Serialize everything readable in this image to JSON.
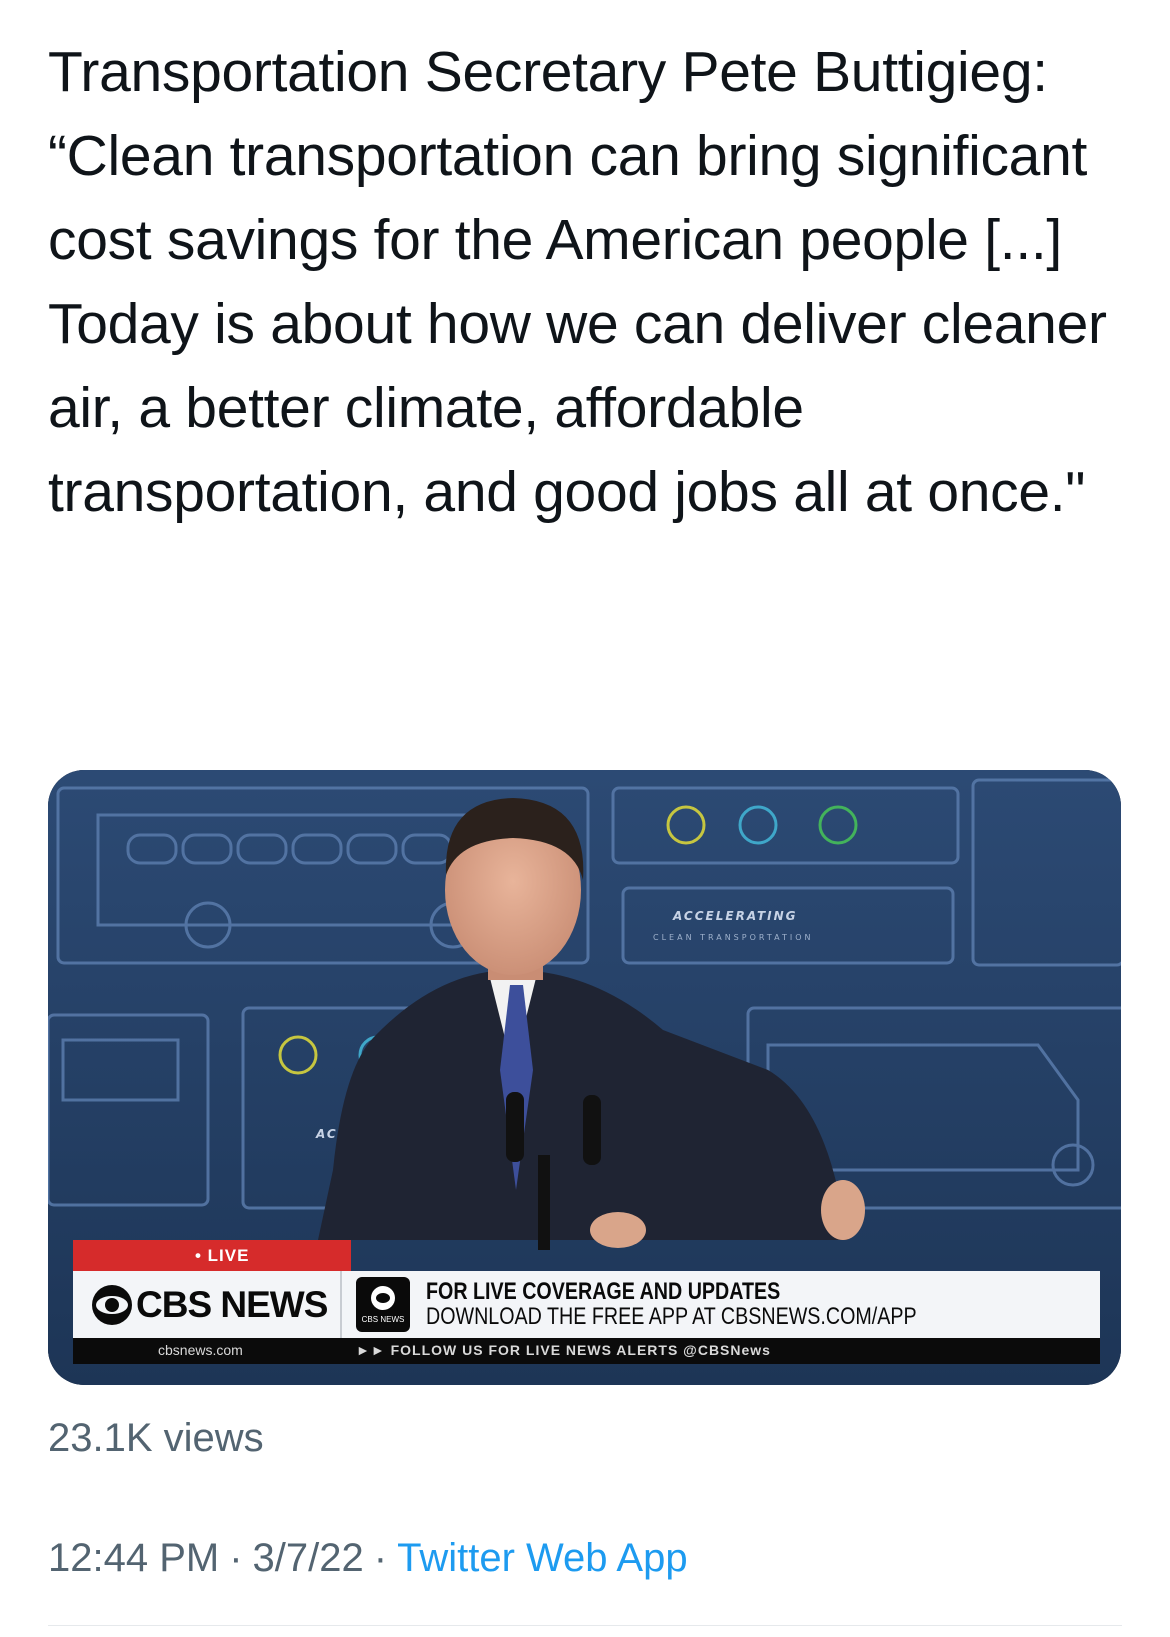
{
  "tweet": {
    "text": "Transportation Secretary Pete Buttigieg: “Clean transportation can bring significant cost savings for the American people [...] Today is about how we can deliver cleaner air, a better climate, affordable transportation, and good jobs all at once.\""
  },
  "video": {
    "backdrop_text_1": "ACCELERATING",
    "backdrop_text_2": "CLEAN TRANSPORTATION",
    "backdrop_text_3": "ACCE",
    "live_label": "• LIVE",
    "network_name": "CBS NEWS",
    "app_badge_label": "CBS NEWS",
    "promo_line1": "FOR LIVE COVERAGE AND UPDATES",
    "promo_line2": "DOWNLOAD THE FREE APP AT CBSNEWS.COM/APP",
    "ticker_url": "cbsnews.com",
    "ticker_text": "►► FOLLOW US FOR LIVE NEWS ALERTS @CBSNews"
  },
  "stats": {
    "views": "23.1K views"
  },
  "meta": {
    "time": "12:44 PM",
    "separator": "·",
    "date": "3/7/22",
    "source": "Twitter Web App"
  },
  "colors": {
    "text": "#0f1419",
    "secondary": "#536471",
    "link": "#1d9bf0",
    "backdrop": "#243a5e",
    "live_red": "#d62b2b"
  },
  "icons": {
    "cbs_logo": "cbs-eye-icon",
    "app_badge": "cbs-app-icon"
  }
}
